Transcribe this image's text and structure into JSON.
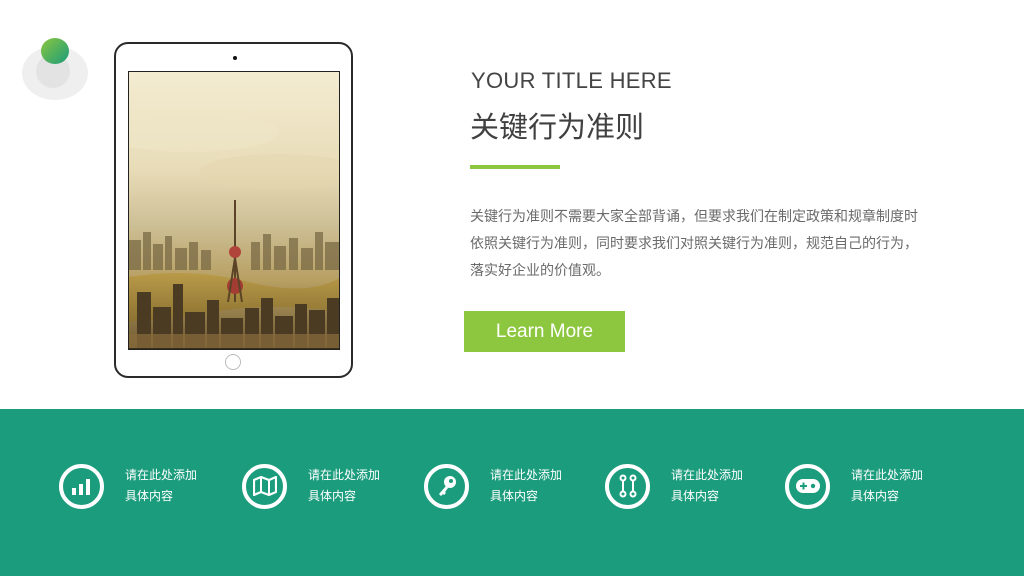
{
  "logo": {
    "icon": "green-circle-logo",
    "colors": {
      "start": "#8cc63f",
      "end": "#1a9c7a"
    }
  },
  "tablet": {
    "image": "city-skyline-photo"
  },
  "content": {
    "title_en": "YOUR TITLE HERE",
    "title_cn": "关键行为准则",
    "description": "关键行为准则不需要大家全部背诵，但要求我们在制定政策和规章制度时依照关键行为准则，同时要求我们对照关键行为准则，规范自己的行为，落实好企业的价值观。",
    "button_label": "Learn More"
  },
  "colors": {
    "accent": "#8dc63f",
    "band": "#1b9c7c",
    "text": "#404040"
  },
  "features": [
    {
      "icon": "bar-chart-icon",
      "line1": "请在此处添加",
      "line2": "具体内容"
    },
    {
      "icon": "map-icon",
      "line1": "请在此处添加",
      "line2": "具体内容"
    },
    {
      "icon": "key-icon",
      "line1": "请在此处添加",
      "line2": "具体内容"
    },
    {
      "icon": "connector-icon",
      "line1": "请在此处添加",
      "line2": "具体内容"
    },
    {
      "icon": "gamepad-icon",
      "line1": "请在此处添加",
      "line2": "具体内容"
    }
  ]
}
